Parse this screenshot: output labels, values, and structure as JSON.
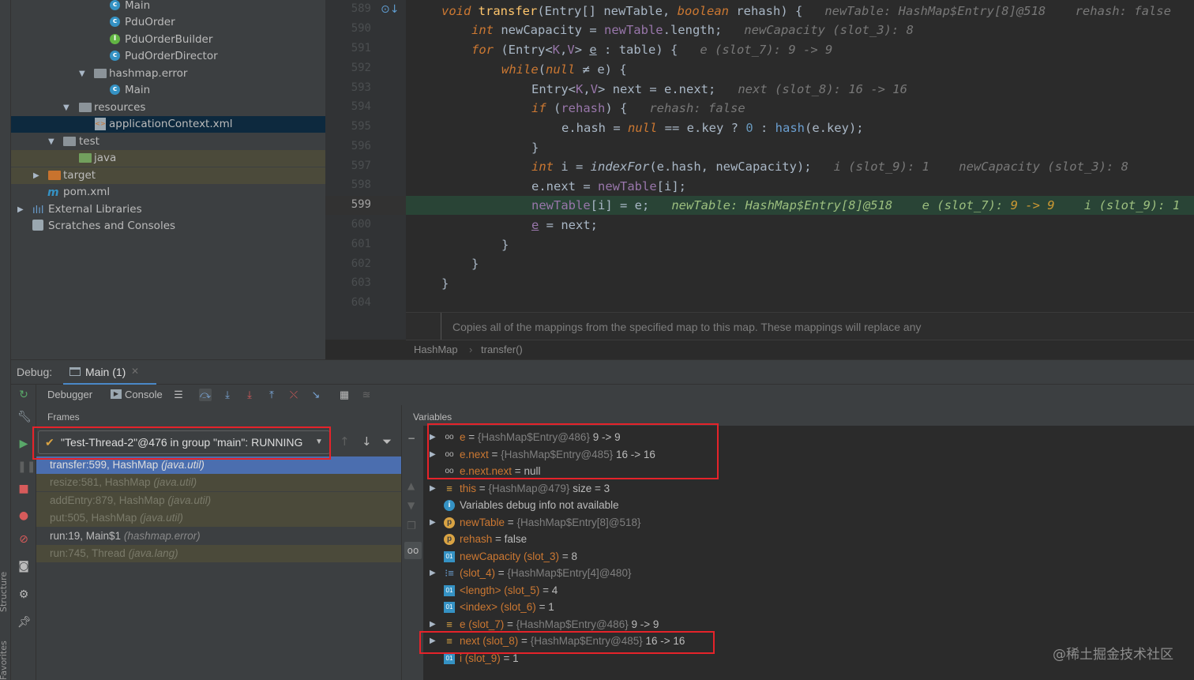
{
  "left_strip": {
    "structure": "Structure",
    "favorites": "Favorites"
  },
  "tree": {
    "items": [
      {
        "label": "Main",
        "icon": "class-icon"
      },
      {
        "label": "PduOrder",
        "icon": "class-icon"
      },
      {
        "label": "PduOrderBuilder",
        "icon": "interface-icon"
      },
      {
        "label": "PudOrderDirector",
        "icon": "class-icon"
      },
      {
        "label": "hashmap.error",
        "icon": "package-icon"
      },
      {
        "label": "Main",
        "icon": "class-icon"
      },
      {
        "label": "resources",
        "icon": "folder-icon"
      },
      {
        "label": "applicationContext.xml",
        "icon": "xml-file-icon"
      },
      {
        "label": "test",
        "icon": "folder-icon"
      },
      {
        "label": "java",
        "icon": "folder-icon"
      },
      {
        "label": "target",
        "icon": "folder-icon"
      },
      {
        "label": "pom.xml",
        "icon": "maven-icon"
      },
      {
        "label": "External Libraries",
        "icon": "library-icon"
      },
      {
        "label": "Scratches and Consoles",
        "icon": "scratch-icon"
      }
    ]
  },
  "gutter": {
    "lines": [
      "589",
      "590",
      "591",
      "592",
      "593",
      "594",
      "595",
      "596",
      "597",
      "598",
      "599",
      "600",
      "601",
      "602",
      "603",
      "604"
    ]
  },
  "editor": {
    "doc_comment": "Copies all of the mappings from the specified map to this map. These mappings will replace any",
    "breadcrumb": [
      "HashMap",
      "transfer()"
    ],
    "code": {
      "l1": {
        "void": "void",
        "name": "transfer",
        "p1": "(Entry[] ",
        "newTable": "newTable",
        "comma": ", ",
        "boolean": "boolean",
        "rehash": " rehash",
        "end": ") {",
        "hint": "newTable: HashMap$Entry[8]@518    rehash: false"
      },
      "l2": {
        "int": "int",
        "rest": " newCapacity = ",
        "newTable": "newTable",
        "len": ".length;",
        "hint": "newCapacity (slot_3): 8"
      },
      "l3": {
        "for": "for",
        "open": " (Entry<",
        "K": "K",
        "c": ",",
        "V": "V",
        "gt": "> ",
        "e": "e",
        "rest": " : table) {",
        "hint": "e (slot_7): 9 -> 9"
      },
      "l4": {
        "while": "while",
        "open": "(",
        "null": "null",
        "rest": " ≠ e) {"
      },
      "l5": {
        "a": "Entry<",
        "K": "K",
        "c": ",",
        "V": "V",
        "rest": "> next = e.next;",
        "hint": "next (slot_8): 16 -> 16"
      },
      "l6": {
        "if": "if",
        "open": " (",
        "rehash": "rehash",
        "rest": ") {",
        "hint": "rehash: false"
      },
      "l7": {
        "a": "e.hash = ",
        "null": "null",
        "b": " == e.key ? ",
        "zero": "0",
        "c": " : ",
        "hash": "hash",
        "d": "(e.key);"
      },
      "l8": {
        "a": "}"
      },
      "l9": {
        "int": "int",
        "a": " i = ",
        "indexFor": "indexFor",
        "b": "(e.hash, newCapacity);",
        "hint": "i (slot_9): 1    newCapacity (slot_3): 8"
      },
      "l10": {
        "a": "e.next = ",
        "newTable": "newTable",
        "b": "[i];"
      },
      "l11": {
        "newTable": "newTable",
        "b": "[i] = e;",
        "hint1": "newTable: HashMap$Entry[8]@518",
        "hint2": "e (slot_7): ",
        "hint2v": "9 -> 9",
        "hint3": "i (slot_9): 1"
      },
      "l12": {
        "e": "e",
        "b": " = next;"
      },
      "l13": {
        "a": "}"
      },
      "l14": {
        "a": "}"
      },
      "l15": {
        "a": "}"
      }
    }
  },
  "debug": {
    "label": "Debug:",
    "tab": "Main (1)",
    "toolbar": {
      "debugger": "Debugger",
      "console": "Console"
    },
    "frames_label": "Frames",
    "variables_label": "Variables",
    "thread": "\"Test-Thread-2\"@476 in group \"main\": RUNNING",
    "frames": [
      {
        "method": "transfer:599, HashMap",
        "pkg": "(java.util)",
        "style": "sel"
      },
      {
        "method": "resize:581, HashMap",
        "pkg": "(java.util)",
        "style": "lib"
      },
      {
        "method": "addEntry:879, HashMap",
        "pkg": "(java.util)",
        "style": "lib"
      },
      {
        "method": "put:505, HashMap",
        "pkg": "(java.util)",
        "style": "lib"
      },
      {
        "method": "run:19, Main$1",
        "pkg": "(hashmap.error)",
        "style": "nrm"
      },
      {
        "method": "run:745, Thread",
        "pkg": "(java.lang)",
        "style": "lib"
      }
    ],
    "variables": [
      {
        "expand": true,
        "icon": "watch-icon",
        "name": "e",
        "ref": "{HashMap$Entry@486}",
        "val": "9 -> 9"
      },
      {
        "expand": true,
        "icon": "watch-icon",
        "name": "e.next",
        "ref": "{HashMap$Entry@485}",
        "val": "16 -> 16"
      },
      {
        "expand": false,
        "icon": "watch-icon",
        "name": "e.next.next",
        "ref": "",
        "val": "null"
      },
      {
        "expand": true,
        "icon": "field-icon",
        "name": "this",
        "ref": "{HashMap@479}",
        "val": " size = 3"
      },
      {
        "expand": false,
        "icon": "info-icon",
        "name": "",
        "ref": "",
        "val": "Variables debug info not available"
      },
      {
        "expand": true,
        "icon": "param-icon",
        "name": "newTable",
        "ref": "{HashMap$Entry[8]@518}",
        "val": ""
      },
      {
        "expand": false,
        "icon": "param-icon",
        "name": "rehash",
        "ref": "",
        "val": "false"
      },
      {
        "expand": false,
        "icon": "primitive-icon",
        "name": "newCapacity (slot_3)",
        "ref": "",
        "val": "8"
      },
      {
        "expand": true,
        "icon": "array-icon",
        "name": "(slot_4)",
        "ref": "{HashMap$Entry[4]@480}",
        "val": ""
      },
      {
        "expand": false,
        "icon": "primitive-icon",
        "name": "<length> (slot_5)",
        "ref": "",
        "val": "4"
      },
      {
        "expand": false,
        "icon": "primitive-icon",
        "name": "<index> (slot_6)",
        "ref": "",
        "val": "1"
      },
      {
        "expand": true,
        "icon": "field-icon",
        "name": "e (slot_7)",
        "ref": "{HashMap$Entry@486}",
        "val": "9 -> 9"
      },
      {
        "expand": true,
        "icon": "field-icon",
        "name": "next (slot_8)",
        "ref": "{HashMap$Entry@485}",
        "val": "16 -> 16"
      },
      {
        "expand": false,
        "icon": "primitive-icon",
        "name": "i (slot_9)",
        "ref": "",
        "val": "1"
      }
    ]
  },
  "watermark": "@稀土掘金技术社区",
  "colors": {
    "highlight_box": "#e5232a",
    "exec_line": "#294436",
    "selected_frame": "#4b6eaf"
  }
}
